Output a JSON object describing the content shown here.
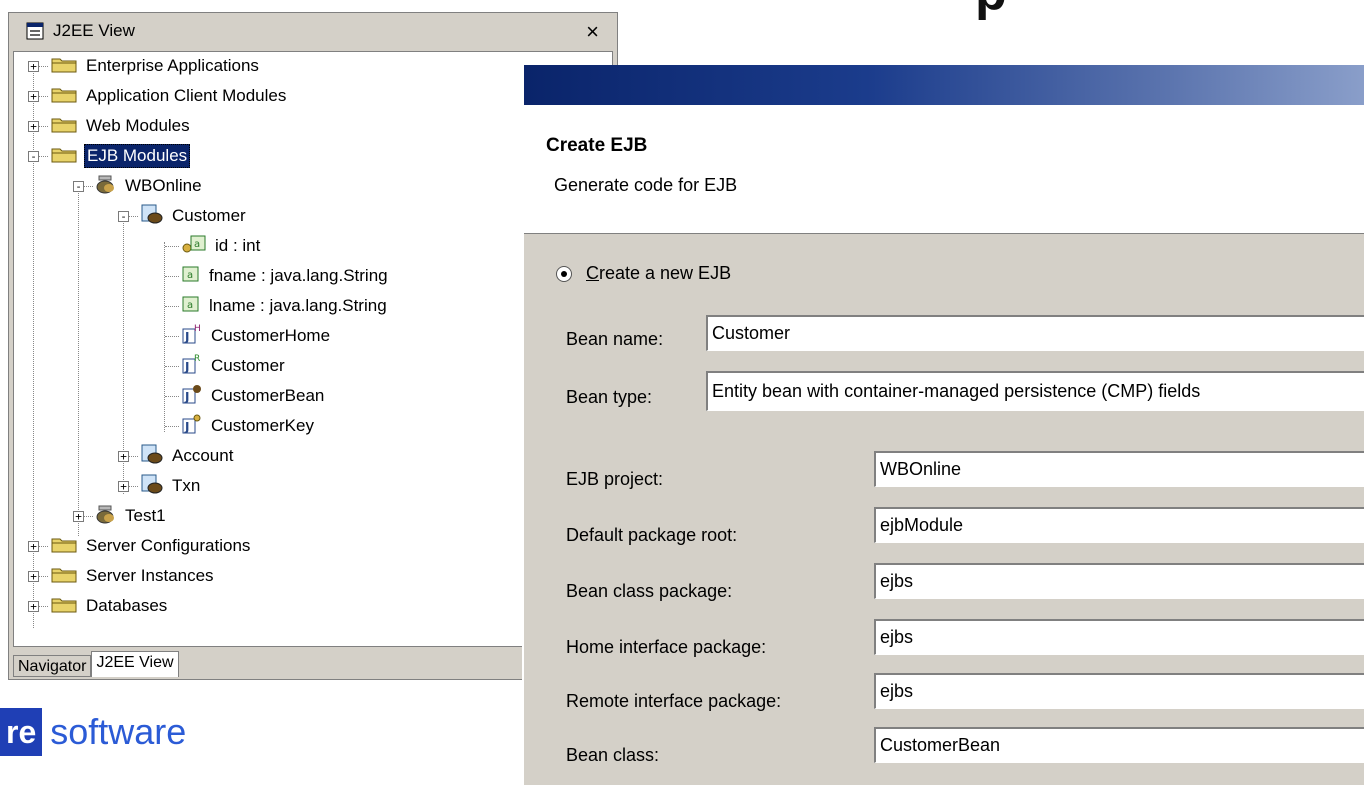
{
  "panel": {
    "title": "J2EE View",
    "close_glyph": "×",
    "tree": [
      {
        "label": "Enterprise Applications",
        "icon": "folder-icon"
      },
      {
        "label": "Application Client Modules",
        "icon": "folder-icon"
      },
      {
        "label": "Web Modules",
        "icon": "folder-icon"
      },
      {
        "label": "EJB Modules",
        "icon": "folder-icon"
      },
      {
        "label": "WBOnline",
        "icon": "ejb-jar-icon"
      },
      {
        "label": "Customer",
        "icon": "bean-icon"
      },
      {
        "label": "id : int",
        "icon": "key-field-icon"
      },
      {
        "label": "fname : java.lang.String",
        "icon": "field-icon"
      },
      {
        "label": "lname : java.lang.String",
        "icon": "field-icon"
      },
      {
        "label": "CustomerHome",
        "icon": "home-interface-icon"
      },
      {
        "label": "Customer",
        "icon": "remote-interface-icon"
      },
      {
        "label": "CustomerBean",
        "icon": "bean-class-icon"
      },
      {
        "label": "CustomerKey",
        "icon": "key-class-icon"
      },
      {
        "label": "Account",
        "icon": "bean-icon"
      },
      {
        "label": "Txn",
        "icon": "bean-icon"
      },
      {
        "label": "Test1",
        "icon": "ejb-jar-icon"
      },
      {
        "label": "Server Configurations",
        "icon": "folder-icon"
      },
      {
        "label": "Server Instances",
        "icon": "folder-icon"
      },
      {
        "label": "Databases",
        "icon": "folder-icon"
      }
    ],
    "tabs": [
      "Navigator",
      "J2EE View"
    ]
  },
  "brand": {
    "box_text": "re",
    "text": "software"
  },
  "dialog": {
    "title": "Create EJB",
    "subtitle": "Generate code for EJB",
    "radio_label": "Create a new EJB",
    "fields": [
      {
        "label": "Bean name:",
        "value": "Customer"
      },
      {
        "label": "Bean type:",
        "value": "Entity bean with container-managed persistence (CMP) fields"
      },
      {
        "label": "EJB project:",
        "value": "WBOnline"
      },
      {
        "label": "Default package root:",
        "value": "ejbModule"
      },
      {
        "label": "Bean class package:",
        "value": "ejbs"
      },
      {
        "label": "Home interface package:",
        "value": "ejbs"
      },
      {
        "label": "Remote interface package:",
        "value": "ejbs"
      },
      {
        "label": "Bean class:",
        "value": "CustomerBean"
      }
    ]
  },
  "colors": {
    "selection": "#0a246a",
    "dialog_bg": "#d4d0c8",
    "brand_blue": "#2b5bd6"
  }
}
